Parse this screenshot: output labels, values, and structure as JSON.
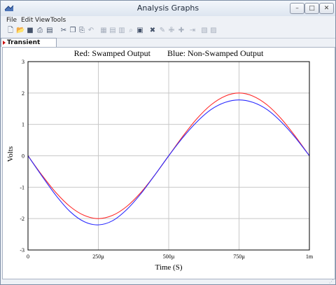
{
  "window": {
    "title": "Analysis Graphs"
  },
  "menu": {
    "items": [
      "File",
      "Edit",
      "View",
      "Tools"
    ]
  },
  "toolbar": {
    "icons": [
      "new-icon",
      "open-icon",
      "save-icon",
      "print-icon",
      "print-preview-icon",
      "cut-icon",
      "copy-icon",
      "paste-icon",
      "undo-icon",
      "grid-icon",
      "grid-minor-icon",
      "table-icon",
      "zoom-icon",
      "zoom-area-icon",
      "cursor-icon",
      "pen-icon",
      "cursor-add-icon",
      "cursor-remove-icon",
      "export-icon",
      "properties-icon",
      "settings-icon"
    ]
  },
  "tabs": [
    {
      "label": "Transient Analysis",
      "active": true
    }
  ],
  "chart_data": {
    "type": "line",
    "title": "Red: Swamped Output        Blue: Non-Swamped Output",
    "xlabel": "Time (S)",
    "ylabel": "Volts",
    "xlim": [
      0,
      1
    ],
    "ylim": [
      -3,
      3
    ],
    "x_ticks": [
      0,
      0.25,
      0.5,
      0.75,
      1
    ],
    "x_tick_labels": [
      "0",
      "250µ",
      "500µ",
      "750µ",
      "1m"
    ],
    "y_ticks": [
      3,
      2,
      1,
      0,
      -1,
      -2,
      -3
    ],
    "y_tick_labels": [
      "3",
      "2",
      "1",
      "0",
      "-1",
      "-2",
      "-3"
    ],
    "grid": true,
    "series": [
      {
        "color": "#ff2a2a",
        "x": [
          0,
          0.05,
          0.1,
          0.15,
          0.2,
          0.25,
          0.3,
          0.35,
          0.4,
          0.45,
          0.5,
          0.55,
          0.6,
          0.65,
          0.7,
          0.75,
          0.8,
          0.85,
          0.9,
          0.95,
          1.0
        ],
        "y": [
          0,
          -0.62,
          -1.18,
          -1.62,
          -1.9,
          -2.0,
          -1.9,
          -1.62,
          -1.18,
          -0.62,
          0,
          0.62,
          1.18,
          1.62,
          1.9,
          2.0,
          1.9,
          1.62,
          1.18,
          0.62,
          0
        ]
      },
      {
        "color": "#2a2aff",
        "x": [
          0,
          0.05,
          0.1,
          0.15,
          0.2,
          0.25,
          0.3,
          0.35,
          0.4,
          0.45,
          0.5,
          0.55,
          0.6,
          0.65,
          0.7,
          0.75,
          0.8,
          0.85,
          0.9,
          0.95,
          1.0
        ],
        "y": [
          0,
          -0.65,
          -1.27,
          -1.78,
          -2.1,
          -2.2,
          -2.07,
          -1.72,
          -1.22,
          -0.62,
          0,
          0.58,
          1.08,
          1.47,
          1.7,
          1.78,
          1.7,
          1.47,
          1.08,
          0.58,
          0
        ]
      }
    ]
  }
}
